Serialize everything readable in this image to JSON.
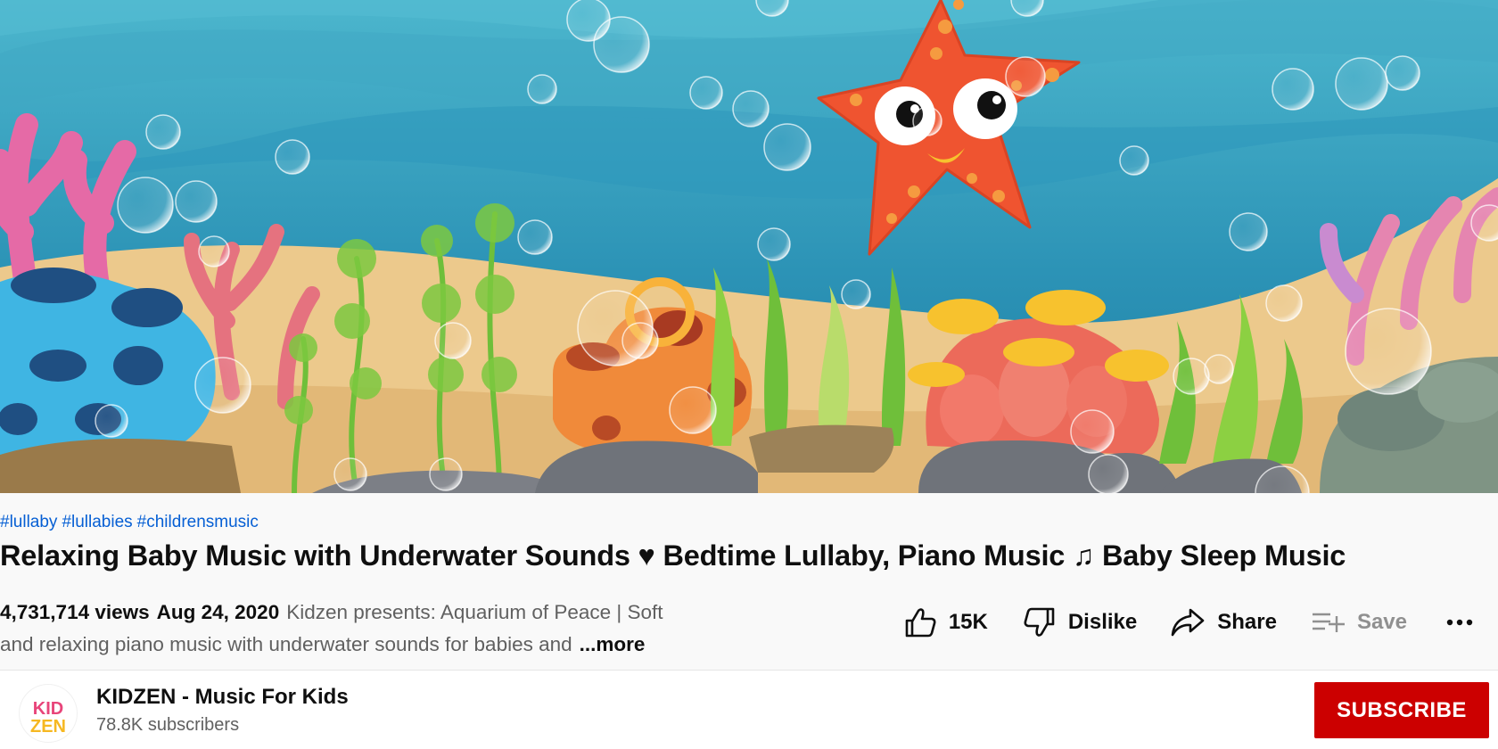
{
  "video": {
    "scene": "underwater-starfish-thumbnail",
    "colors": {
      "water_deep": "#1f7fa5",
      "water_light": "#4bb4cc",
      "sand": "#ecc98c",
      "starfish": "#ef5430"
    }
  },
  "hashtags": [
    "#lullaby",
    "#lullabies",
    "#childrensmusic"
  ],
  "title": "Relaxing Baby Music with Underwater Sounds ♥ Bedtime Lullaby, Piano Music ♫ Baby Sleep Music",
  "description": {
    "views": "4,731,714 views",
    "date": "Aug 24, 2020",
    "line1": "Kidzen presents: Aquarium of Peace | Soft",
    "line2": "and relaxing piano music with underwater sounds for babies and",
    "more_label": "...more"
  },
  "actions": {
    "like_count": "15K",
    "dislike_label": "Dislike",
    "share_label": "Share",
    "save_label": "Save"
  },
  "channel": {
    "name": "KIDZEN - Music For Kids",
    "subscribers": "78.8K subscribers",
    "logo_text_top": "KID",
    "logo_text_bottom": "ZEN"
  },
  "subscribe_label": "SUBSCRIBE",
  "colors": {
    "link": "#065fd4",
    "subscribe_bg": "#cc0000",
    "secondary_text": "#606060"
  }
}
